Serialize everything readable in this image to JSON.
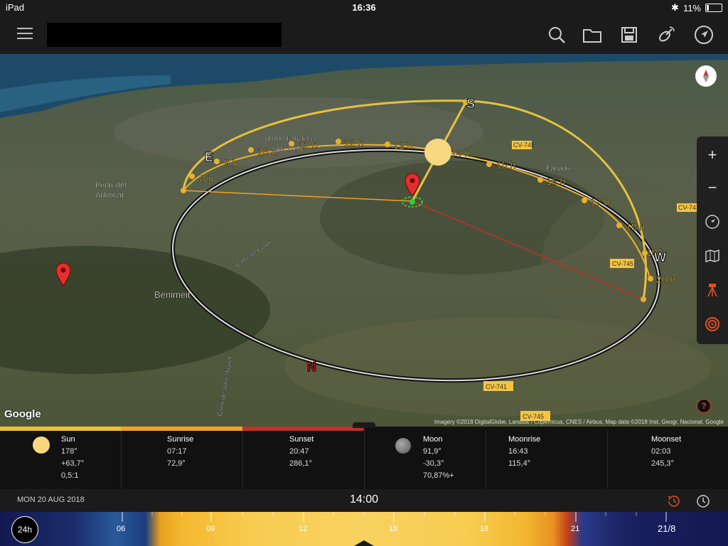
{
  "status": {
    "device": "iPad",
    "time": "16:36",
    "battery": "11%"
  },
  "toolbar": {
    "icons": [
      "search-icon",
      "folder-icon",
      "save-icon",
      "satellite-icon",
      "location-icon"
    ]
  },
  "map": {
    "hours": [
      "8 h",
      "9 h",
      "10 h",
      "11 h",
      "12 h",
      "13 h",
      "14 h",
      "15 h",
      "16 h",
      "17 h",
      "18 h",
      "19 h",
      "20 h"
    ],
    "cardinals": {
      "n": "N",
      "s": "S",
      "e": "E",
      "w": "W"
    },
    "places": {
      "pinar1": "Pinar del",
      "pinar2": "Advocat",
      "benimeit": "Benimeit",
      "urb": "URBANIZACIÓN",
      "jaime": "SAN JAIME",
      "fanadix": "Fanadix",
      "cami": "Camí de Sant Miquel",
      "cami2": "Camí de Garbí"
    },
    "roads": {
      "cv745a": "CV-745",
      "cv745b": "CV-745",
      "cv741a": "CV-741",
      "cv741b": "CV-741",
      "cv745c": "CV-745"
    },
    "google": "Google",
    "attribution": "Imagery ©2018 DigitalGlobe, Landsat / Copernicus, CNES / Airbus, Map data ©2018 Inst. Geogr. Nacional, Google",
    "help": "?"
  },
  "info": {
    "sun": {
      "label": "Sun",
      "v1": "178°",
      "v2": "+63,7°",
      "v3": "0,5:1"
    },
    "sunrise": {
      "label": "Sunrise",
      "v1": "07:17",
      "v2": "72,9°"
    },
    "sunset": {
      "label": "Sunset",
      "v1": "20:47",
      "v2": "286,1°"
    },
    "moon": {
      "label": "Moon",
      "v1": "91,9°",
      "v2": "-30,3°",
      "v3": "70,87%+"
    },
    "moonrise": {
      "label": "Moonrise",
      "v1": "16:43",
      "v2": "115,4°"
    },
    "moonset": {
      "label": "Moonset",
      "v1": "02:03",
      "v2": "245,3°"
    }
  },
  "datebar": {
    "date": "MON 20 AUG 2018",
    "time": "14:00"
  },
  "timeline": {
    "h24": "24h",
    "ticks": [
      "06",
      "09",
      "12",
      "15",
      "18",
      "21",
      "21/8"
    ]
  },
  "colors": {
    "sun": "#f7d060",
    "sunrise": "#f0a020",
    "sunset": "#c0302a",
    "path": "#e8c040"
  }
}
